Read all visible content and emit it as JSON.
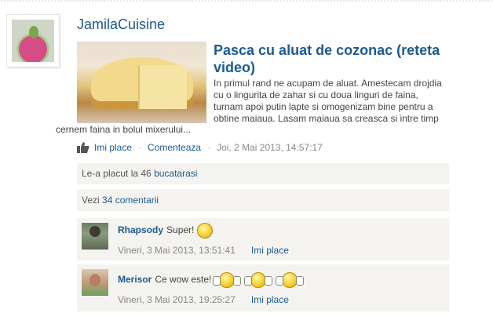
{
  "author": {
    "name": "JamilaCuisine"
  },
  "post": {
    "title": "Pasca cu aluat de cozonac (reteta video)",
    "excerpt_lead": "In primul rand ne acupam de aluat. Amestecam drojdia cu o lingurita de zahar si cu doua linguri de faina, turnam apoi putin lapte si omogenizam bine pentru a obtine maiaua. Lasam maiaua sa creasca si intre timp",
    "excerpt_tail": "cernem faina in bolul mixerului..."
  },
  "actions": {
    "like_label": "Imi place",
    "separator": "·",
    "comment_label": "Comenteaza",
    "date": "Joi, 2 Mai 2013, 14:57:17"
  },
  "likes": {
    "text": "Le-a placut la 46",
    "link": "bucatarasi"
  },
  "comments_summary": {
    "text": "Vezi",
    "link": "34 comentarii"
  },
  "comments": [
    {
      "author": "Rhapsody",
      "text": "Super!",
      "date": "Vineri, 3 Mai 2013, 13:51:41",
      "like_label": "Imi place"
    },
    {
      "author": "Merisor",
      "text": "Ce wow este!",
      "date": "Vineri, 3 Mai 2013, 19:25:27",
      "like_label": "Imi place"
    }
  ],
  "colors": {
    "link": "#1d5a8f",
    "panel": "#f4f3ef"
  }
}
